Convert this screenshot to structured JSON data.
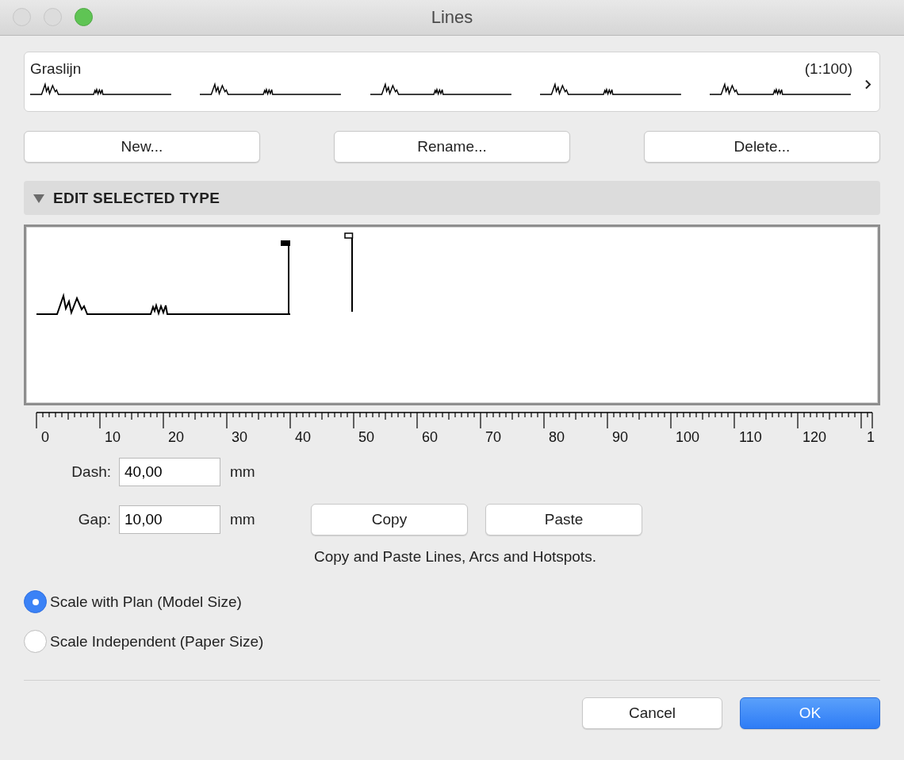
{
  "window": {
    "title": "Lines"
  },
  "line_type": {
    "name": "Graslijn",
    "scale": "(1:100)"
  },
  "type_buttons": [
    {
      "label": "New..."
    },
    {
      "label": "Rename..."
    },
    {
      "label": "Delete..."
    }
  ],
  "section": {
    "title": "EDIT SELECTED TYPE",
    "expanded": true
  },
  "ruler": {
    "labels": [
      "0",
      "10",
      "20",
      "30",
      "40",
      "50",
      "60",
      "70",
      "80",
      "90",
      "100",
      "110",
      "120",
      "1"
    ]
  },
  "fields": [
    {
      "label": "Dash:",
      "value": "40,00",
      "unit": "mm"
    },
    {
      "label": "Gap:",
      "value": "10,00",
      "unit": "mm"
    }
  ],
  "clipboard_buttons": [
    {
      "label": "Copy"
    },
    {
      "label": "Paste"
    }
  ],
  "clipboard_note": "Copy and Paste Lines, Arcs and Hotspots.",
  "scale_options": [
    {
      "label": "Scale with Plan (Model Size)",
      "selected": true
    },
    {
      "label": "Scale Independent (Paper Size)",
      "selected": false
    }
  ],
  "footer_buttons": [
    {
      "label": "Cancel",
      "kind": "secondary"
    },
    {
      "label": "OK",
      "kind": "primary"
    }
  ]
}
